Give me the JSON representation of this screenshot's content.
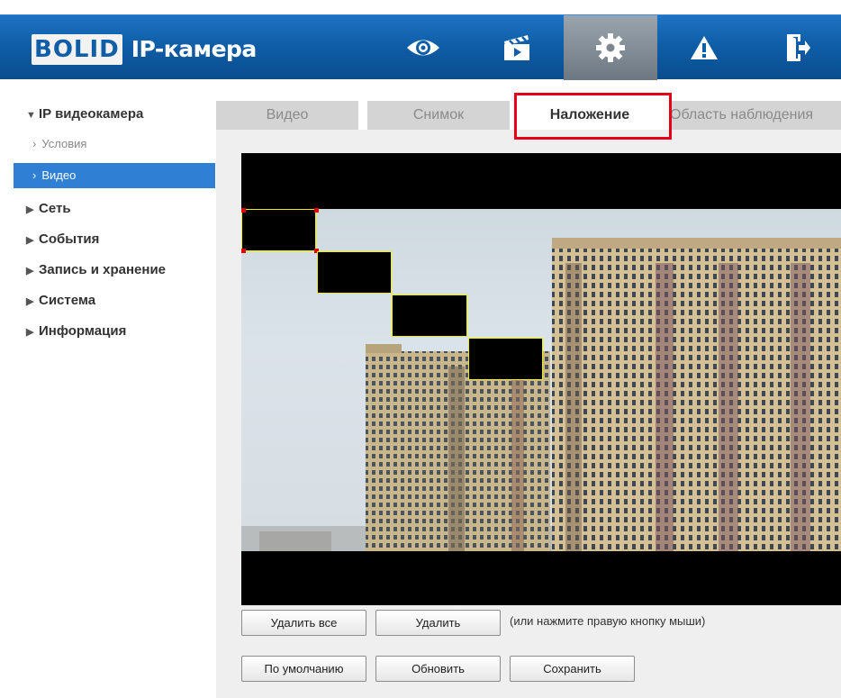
{
  "header": {
    "brand": "BOLID",
    "product": "IP-камера",
    "nav": [
      {
        "icon": "eye-icon"
      },
      {
        "icon": "clapperboard-icon"
      },
      {
        "icon": "gear-icon",
        "active": true
      },
      {
        "icon": "warning-icon"
      },
      {
        "icon": "exit-icon"
      }
    ]
  },
  "sidebar": {
    "root": "IP видеокамера",
    "sub_items": [
      "Условия",
      "Видео"
    ],
    "active_sub": "Видео",
    "groups": [
      "Сеть",
      "События",
      "Запись и хранение",
      "Система",
      "Информация"
    ]
  },
  "tabs": [
    "Видео",
    "Снимок",
    "Наложение",
    "Область наблюдения"
  ],
  "active_tab": "Наложение",
  "privacy_masks": {
    "count": 4
  },
  "buttons": {
    "delete_all": "Удалить все",
    "delete": "Удалить",
    "hint": "(или нажмите правую кнопку мыши)",
    "default": "По умолчанию",
    "refresh": "Обновить",
    "save": "Сохранить"
  },
  "colors": {
    "header_blue": "#0f5ea8",
    "active_item": "#2f7fd4",
    "highlight": "#e6001a",
    "mask_border": "#f0f000"
  }
}
